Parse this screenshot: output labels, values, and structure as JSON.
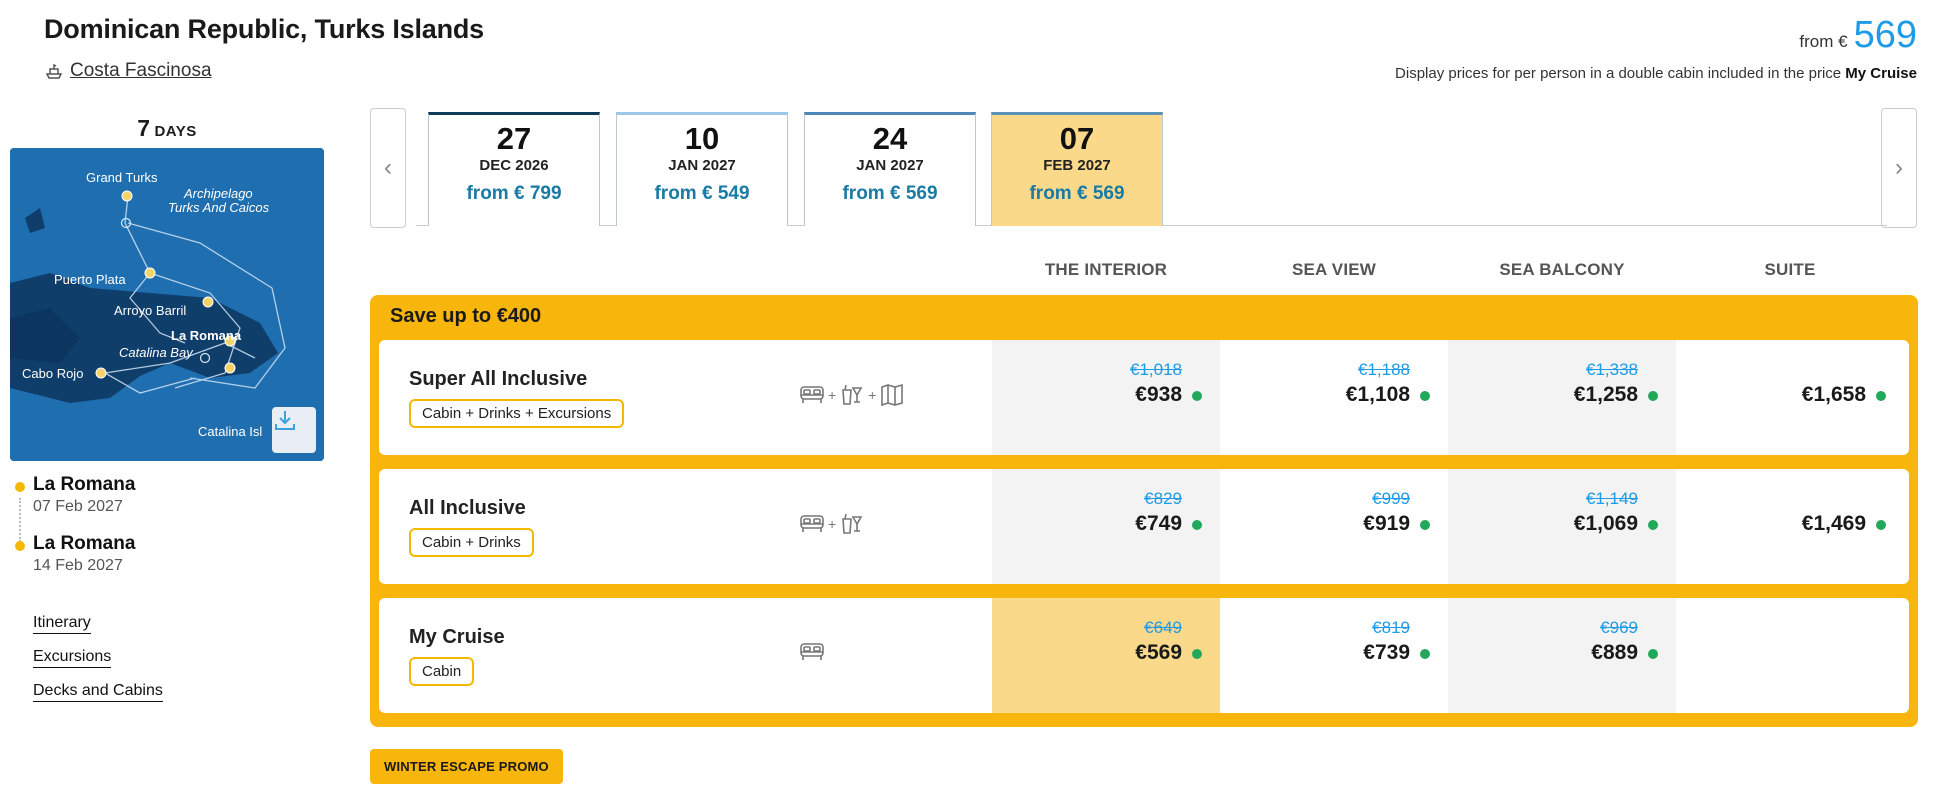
{
  "header": {
    "title": "Dominican Republic, Turks Islands",
    "ship": "Costa Fascinosa",
    "price_from_label": "from €",
    "price_from_value": "569",
    "disclaimer_text": "Display prices for per person in a double cabin included in the price",
    "disclaimer_bold": "My Cruise"
  },
  "duration": {
    "number": "7",
    "unit": "DAYS"
  },
  "map": {
    "labels": {
      "grand_turks": "Grand Turks",
      "archipelago_1": "Archipelago",
      "archipelago_2": "Turks And Caicos",
      "puerto_plata": "Puerto Plata",
      "arroyo_barril": "Arroyo Barril",
      "la_romana": "La Romana",
      "catalina_bay": "Catalina Bay",
      "cabo_rojo": "Cabo Rojo",
      "catalina_island": "Catalina Isl"
    },
    "download_icon": "download-icon"
  },
  "ports": [
    {
      "name": "La Romana",
      "date": "07 Feb 2027"
    },
    {
      "name": "La Romana",
      "date": "14 Feb 2027"
    }
  ],
  "links": [
    "Itinerary",
    "Excursions",
    "Decks and Cabins"
  ],
  "date_tabs": [
    {
      "day": "27",
      "month": "DEC 2026",
      "price": "from € 799"
    },
    {
      "day": "10",
      "month": "JAN 2027",
      "price": "from € 549"
    },
    {
      "day": "24",
      "month": "JAN 2027",
      "price": "from € 569"
    },
    {
      "day": "07",
      "month": "FEB 2027",
      "price": "from € 569",
      "selected": true
    }
  ],
  "columns": [
    "THE INTERIOR",
    "SEA VIEW",
    "SEA BALCONY",
    "SUITE"
  ],
  "save_banner": "Save up to €400",
  "offers": [
    {
      "name": "Super All Inclusive",
      "badge": "Cabin + Drinks + Excursions",
      "icons": [
        "bed-icon",
        "drinks-icon",
        "map-icon"
      ],
      "prices": [
        {
          "old": "€1,018",
          "new": "€938"
        },
        {
          "old": "€1,188",
          "new": "€1,108"
        },
        {
          "old": "€1,338",
          "new": "€1,258"
        },
        {
          "old": "",
          "new": "€1,658"
        }
      ]
    },
    {
      "name": "All Inclusive",
      "badge": "Cabin + Drinks",
      "icons": [
        "bed-icon",
        "drinks-icon"
      ],
      "prices": [
        {
          "old": "€829",
          "new": "€749"
        },
        {
          "old": "€999",
          "new": "€919"
        },
        {
          "old": "€1,149",
          "new": "€1,069"
        },
        {
          "old": "",
          "new": "€1,469"
        }
      ]
    },
    {
      "name": "My Cruise",
      "badge": "Cabin",
      "icons": [
        "bed-icon"
      ],
      "prices": [
        {
          "old": "€649",
          "new": "€569"
        },
        {
          "old": "€819",
          "new": "€739"
        },
        {
          "old": "€969",
          "new": "€889"
        },
        {
          "old": "",
          "new": ""
        }
      ]
    }
  ],
  "icon_plus": "+",
  "promo_label": "WINTER ESCAPE PROMO",
  "colors": {
    "accent": "#f8b50c",
    "price_blue": "#1e9be6",
    "selected_bg": "#fbd98a",
    "avail_dot": "#22a85a"
  }
}
